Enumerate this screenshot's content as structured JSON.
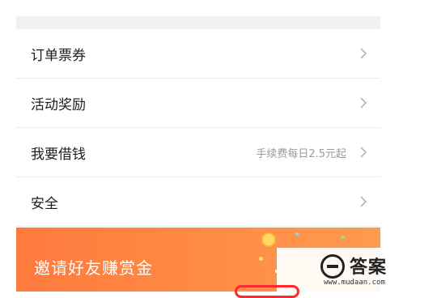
{
  "menu": {
    "items": [
      {
        "label": "订单票券",
        "sub": ""
      },
      {
        "label": "活动奖励",
        "sub": ""
      },
      {
        "label": "我要借钱",
        "sub": "手续费每日2.5元起"
      },
      {
        "label": "安全",
        "sub": ""
      }
    ]
  },
  "banner": {
    "title": "邀请好友赚赏金"
  },
  "watermark": {
    "text": "答案",
    "url": "www.mudaan.com"
  },
  "colors": {
    "banner_start": "#ff7a3d",
    "banner_end": "#ff9a50",
    "accent_red": "#ff2b2b"
  },
  "icons": {
    "chevron": "chevron-right-icon"
  }
}
